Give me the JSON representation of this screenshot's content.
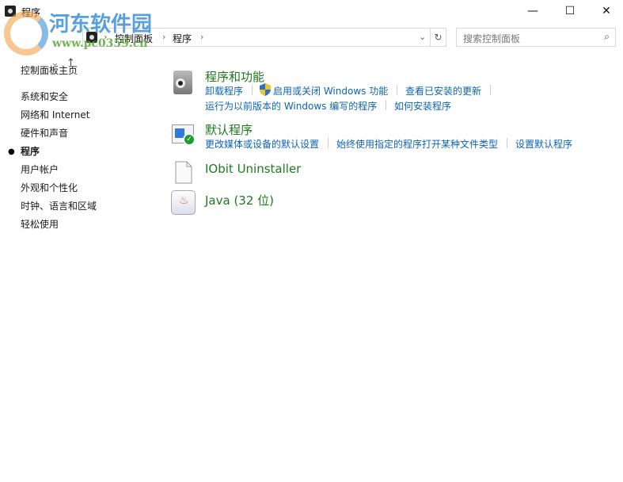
{
  "window": {
    "title": "程序",
    "minimize": "—",
    "maximize": "☐",
    "close": "✕"
  },
  "address": {
    "crumbs": [
      "控制面板",
      "程序"
    ],
    "search_placeholder": "搜索控制面板"
  },
  "sidebar": {
    "items": [
      "控制面板主页",
      "系统和安全",
      "网络和 Internet",
      "硬件和声音",
      "程序",
      "用户帐户",
      "外观和个性化",
      "时钟、语言和区域",
      "轻松使用"
    ],
    "active": "程序"
  },
  "sections": {
    "programs": {
      "title": "程序和功能",
      "links": [
        "卸载程序",
        "启用或关闭 Windows 功能",
        "查看已安装的更新",
        "运行为以前版本的 Windows 编写的程序",
        "如何安装程序"
      ]
    },
    "defaults": {
      "title": "默认程序",
      "links": [
        "更改媒体或设备的默认设置",
        "始终使用指定的程序打开某种文件类型",
        "设置默认程序"
      ]
    },
    "iobit": {
      "title": "IObit Uninstaller"
    },
    "java": {
      "title": "Java (32 位)"
    }
  },
  "watermark": {
    "name": "河东软件园",
    "url": "www.pc0359.cn"
  }
}
